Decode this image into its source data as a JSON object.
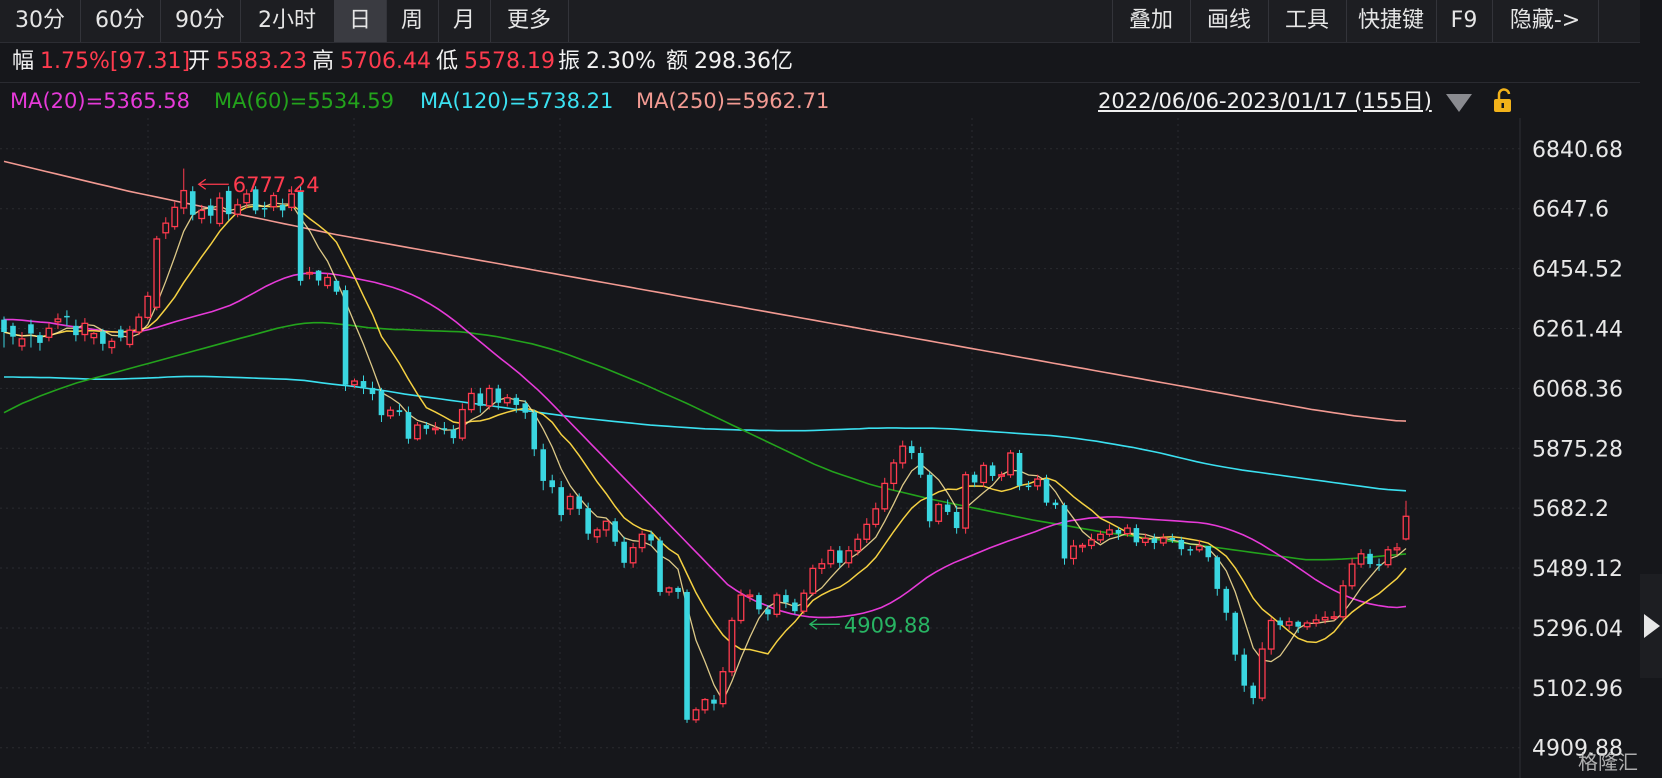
{
  "toolbar": {
    "periods": [
      "30分",
      "60分",
      "90分",
      "2小时",
      "日",
      "周",
      "月",
      "更多"
    ],
    "active": "日",
    "tools": [
      "叠加",
      "画线",
      "工具",
      "快捷键",
      "F9",
      "隐藏->"
    ]
  },
  "info": {
    "change_label": "幅",
    "change_value": "1.75%[97.31]",
    "open_label": "开",
    "open_value": "5583.23",
    "high_label": "高",
    "high_value": "5706.44",
    "low_label": "低",
    "low_value": "5578.19",
    "amp_label": "振",
    "amp_value": "2.30%",
    "amount_label": "额",
    "amount_value": "298.36亿"
  },
  "ma": [
    {
      "text": "MA(20)=5365.58",
      "color": "#e63ad8"
    },
    {
      "text": "MA(60)=5534.59",
      "color": "#23a31c"
    },
    {
      "text": "MA(120)=5738.21",
      "color": "#3be0f0"
    },
    {
      "text": "MA(250)=5962.71",
      "color": "#f29a92"
    }
  ],
  "date_range": "2022/06/06-2023/01/17 (155日)",
  "watermark": "格隆汇",
  "colors": {
    "up": "#ff3b4e",
    "down": "#3ad6e0",
    "ma5": "#f0f0f0",
    "ma10": "#f5d142"
  },
  "icons": {
    "dropdown": "triangle-down-icon",
    "lock": "lock-icon",
    "play": "play-icon"
  },
  "chart_data": {
    "type": "candlestick",
    "ylim": [
      4909,
      6940
    ],
    "yticks": [
      "6840.68",
      "6647.6",
      "6454.52",
      "6261.44",
      "6068.36",
      "5875.28",
      "5682.2",
      "5489.12",
      "5296.04",
      "5102.96",
      "4909.88"
    ],
    "annotations": [
      {
        "text": "6777.24",
        "kind": "high",
        "index": 21
      },
      {
        "text": "4909.88",
        "kind": "low",
        "index": 89
      }
    ],
    "closes": [
      6250,
      6235,
      6228,
      6245,
      6215,
      6262,
      6292,
      6300,
      6240,
      6278,
      6245,
      6212,
      6220,
      6232,
      6256,
      6298,
      6365,
      6550,
      6601,
      6652,
      6706,
      6628,
      6642,
      6625,
      6682,
      6630,
      6660,
      6695,
      6642,
      6645,
      6690,
      6642,
      6695,
      6415,
      6442,
      6416,
      6426,
      6380,
      6080,
      6092,
      6072,
      6050,
      5982,
      5998,
      5992,
      5906,
      5950,
      5938,
      5940,
      5936,
      5908,
      6000,
      6052,
      6012,
      6068,
      6022,
      6038,
      6015,
      5990,
      5872,
      5770,
      5750,
      5660,
      5720,
      5680,
      5600,
      5612,
      5640,
      5574,
      5506,
      5555,
      5598,
      5578,
      5412,
      5425,
      5412,
      5000,
      5032,
      5065,
      5052,
      5155,
      5320,
      5402,
      5402,
      5356,
      5340,
      5402,
      5378,
      5350,
      5408,
      5488,
      5503,
      5546,
      5506,
      5545,
      5582,
      5630,
      5680,
      5762,
      5828,
      5882,
      5860,
      5790,
      5640,
      5694,
      5670,
      5618,
      5790,
      5765,
      5820,
      5786,
      5790,
      5860,
      5755,
      5754,
      5776,
      5700,
      5692,
      5520,
      5560,
      5562,
      5580,
      5598,
      5612,
      5600,
      5618,
      5572,
      5585,
      5570,
      5586,
      5580,
      5550,
      5548,
      5560,
      5524,
      5422,
      5345,
      5210,
      5110,
      5070,
      5228,
      5320,
      5305,
      5316,
      5300,
      5312,
      5322,
      5330,
      5332,
      5432,
      5502,
      5535,
      5502,
      5500,
      5548,
      5554,
      5656
    ],
    "opens": [
      6290,
      6270,
      6205,
      6275,
      6240,
      6233,
      6283,
      6302,
      6270,
      6242,
      6232,
      6252,
      6200,
      6258,
      6210,
      6250,
      6297,
      6330,
      6570,
      6590,
      6650,
      6704,
      6616,
      6658,
      6600,
      6705,
      6630,
      6667,
      6710,
      6650,
      6654,
      6660,
      6652,
      6705,
      6438,
      6448,
      6400,
      6415,
      6385,
      6080,
      6092,
      6070,
      6060,
      5980,
      5998,
      5992,
      5906,
      5950,
      5938,
      5940,
      5936,
      5908,
      6000,
      6052,
      6012,
      6068,
      6022,
      6038,
      6020,
      5990,
      5872,
      5772,
      5750,
      5680,
      5720,
      5682,
      5590,
      5612,
      5640,
      5574,
      5506,
      5555,
      5598,
      5578,
      5412,
      5425,
      5412,
      5000,
      5032,
      5065,
      5052,
      5155,
      5320,
      5402,
      5402,
      5356,
      5340,
      5402,
      5378,
      5350,
      5408,
      5488,
      5503,
      5546,
      5506,
      5545,
      5582,
      5630,
      5680,
      5762,
      5828,
      5882,
      5860,
      5790,
      5640,
      5694,
      5670,
      5618,
      5790,
      5765,
      5820,
      5786,
      5790,
      5860,
      5755,
      5754,
      5776,
      5700,
      5692,
      5520,
      5560,
      5562,
      5580,
      5598,
      5612,
      5600,
      5618,
      5572,
      5585,
      5570,
      5586,
      5580,
      5550,
      5548,
      5560,
      5524,
      5422,
      5345,
      5210,
      5110,
      5070,
      5228,
      5320,
      5305,
      5316,
      5300,
      5312,
      5322,
      5330,
      5332,
      5432,
      5502,
      5535,
      5502,
      5500,
      5548,
      5583
    ],
    "highs": [
      6300,
      6280,
      6250,
      6290,
      6250,
      6280,
      6310,
      6320,
      6290,
      6295,
      6250,
      6260,
      6230,
      6270,
      6270,
      6310,
      6380,
      6560,
      6620,
      6670,
      6777,
      6720,
      6660,
      6680,
      6700,
      6720,
      6680,
      6710,
      6720,
      6670,
      6700,
      6680,
      6720,
      6720,
      6460,
      6450,
      6440,
      6420,
      6400,
      6100,
      6110,
      6090,
      6070,
      6010,
      6020,
      6010,
      5960,
      5960,
      5960,
      5960,
      5950,
      6020,
      6070,
      6070,
      6080,
      6080,
      6050,
      6050,
      6030,
      6000,
      5890,
      5790,
      5770,
      5730,
      5730,
      5700,
      5620,
      5640,
      5650,
      5590,
      5570,
      5610,
      5610,
      5590,
      5430,
      5430,
      5420,
      5040,
      5070,
      5080,
      5170,
      5330,
      5420,
      5420,
      5410,
      5370,
      5410,
      5420,
      5390,
      5420,
      5500,
      5520,
      5560,
      5560,
      5560,
      5600,
      5650,
      5700,
      5780,
      5840,
      5900,
      5900,
      5880,
      5800,
      5700,
      5710,
      5690,
      5800,
      5800,
      5830,
      5830,
      5800,
      5870,
      5870,
      5770,
      5790,
      5790,
      5710,
      5700,
      5580,
      5570,
      5600,
      5610,
      5630,
      5620,
      5630,
      5630,
      5600,
      5600,
      5600,
      5600,
      5590,
      5560,
      5580,
      5560,
      5530,
      5430,
      5350,
      5230,
      5120,
      5250,
      5330,
      5330,
      5330,
      5320,
      5320,
      5340,
      5350,
      5350,
      5450,
      5520,
      5550,
      5550,
      5520,
      5560,
      5570,
      5706
    ],
    "lows": [
      6200,
      6210,
      6190,
      6200,
      6190,
      6220,
      6260,
      6270,
      6220,
      6220,
      6210,
      6190,
      6180,
      6220,
      6200,
      6240,
      6290,
      6320,
      6550,
      6580,
      6630,
      6610,
      6600,
      6600,
      6590,
      6610,
      6620,
      6650,
      6630,
      6620,
      6640,
      6620,
      6640,
      6400,
      6420,
      6400,
      6390,
      6370,
      6060,
      6070,
      6050,
      6030,
      5960,
      5970,
      5980,
      5890,
      5900,
      5920,
      5920,
      5920,
      5890,
      5900,
      5990,
      5990,
      6000,
      6000,
      6010,
      5990,
      5970,
      5850,
      5740,
      5730,
      5640,
      5660,
      5660,
      5580,
      5570,
      5590,
      5560,
      5490,
      5490,
      5540,
      5560,
      5400,
      5400,
      5390,
      4990,
      4990,
      5020,
      5030,
      5040,
      5140,
      5310,
      5380,
      5340,
      5320,
      5330,
      5360,
      5340,
      5340,
      5400,
      5470,
      5490,
      5490,
      5490,
      5530,
      5570,
      5620,
      5670,
      5740,
      5810,
      5840,
      5780,
      5620,
      5630,
      5660,
      5600,
      5600,
      5750,
      5750,
      5770,
      5770,
      5780,
      5740,
      5740,
      5740,
      5690,
      5680,
      5500,
      5500,
      5540,
      5550,
      5570,
      5590,
      5580,
      5590,
      5560,
      5560,
      5550,
      5560,
      5570,
      5530,
      5530,
      5540,
      5510,
      5400,
      5320,
      5190,
      5090,
      5050,
      5060,
      5210,
      5290,
      5290,
      5280,
      5290,
      5300,
      5310,
      5320,
      5320,
      5420,
      5490,
      5490,
      5480,
      5490,
      5530,
      5578
    ],
    "series": [
      {
        "name": "MA(250)",
        "color": "#f29a92",
        "values": [
          6800,
          6792,
          6784,
          6776,
          6768,
          6760,
          6752,
          6744,
          6736,
          6728,
          6720,
          6712,
          6704,
          6697,
          6690,
          6683,
          6676,
          6669,
          6662,
          6655,
          6648,
          6641,
          6634,
          6627,
          6620,
          6613,
          6606,
          6599,
          6592,
          6585,
          6578,
          6571,
          6564,
          6558,
          6552,
          6546,
          6540,
          6534,
          6528,
          6522,
          6516,
          6510,
          6504,
          6498,
          6492,
          6486,
          6480,
          6474,
          6468,
          6462,
          6456,
          6450,
          6444,
          6438,
          6432,
          6426,
          6420,
          6414,
          6408,
          6402,
          6396,
          6390,
          6384,
          6378,
          6372,
          6366,
          6360,
          6354,
          6348,
          6342,
          6336,
          6330,
          6324,
          6318,
          6312,
          6306,
          6300,
          6294,
          6288,
          6282,
          6276,
          6270,
          6264,
          6258,
          6252,
          6246,
          6240,
          6234,
          6228,
          6222,
          6216,
          6210,
          6204,
          6198,
          6192,
          6186,
          6180,
          6174,
          6168,
          6162,
          6156,
          6150,
          6144,
          6138,
          6132,
          6126,
          6120,
          6114,
          6108,
          6102,
          6096,
          6090,
          6084,
          6078,
          6072,
          6066,
          6060,
          6054,
          6048,
          6042,
          6036,
          6030,
          6024,
          6018,
          6012,
          6006,
          6000,
          5995,
          5990,
          5985,
          5980,
          5976,
          5972,
          5968,
          5964,
          5962.71
        ]
      },
      {
        "name": "MA(120)",
        "color": "#3be0f0",
        "values": [
          6105,
          6105,
          6104,
          6104,
          6103,
          6103,
          6102,
          6101,
          6100,
          6099,
          6098,
          6098,
          6098,
          6099,
          6100,
          6101,
          6102,
          6103,
          6105,
          6106,
          6107,
          6107,
          6107,
          6106,
          6105,
          6104,
          6103,
          6102,
          6101,
          6100,
          6099,
          6098,
          6096,
          6094,
          6090,
          6086,
          6082,
          6079,
          6076,
          6072,
          6068,
          6064,
          6060,
          6055,
          6050,
          6046,
          6042,
          6038,
          6034,
          6030,
          6026,
          6022,
          6018,
          6014,
          6010,
          6006,
          6002,
          5998,
          5994,
          5990,
          5986,
          5982,
          5978,
          5974,
          5971,
          5968,
          5965,
          5962,
          5959,
          5956,
          5953,
          5950,
          5948,
          5946,
          5944,
          5942,
          5940,
          5938,
          5937,
          5936,
          5935,
          5934,
          5934,
          5933,
          5933,
          5932,
          5932,
          5932,
          5932,
          5933,
          5934,
          5935,
          5936,
          5937,
          5938,
          5940,
          5940,
          5941,
          5941,
          5940,
          5940,
          5940,
          5940,
          5939,
          5938,
          5936,
          5934,
          5932,
          5930,
          5928,
          5926,
          5924,
          5922,
          5920,
          5918,
          5916,
          5913,
          5910,
          5906,
          5902,
          5898,
          5893,
          5888,
          5883,
          5878,
          5872,
          5866,
          5860,
          5853,
          5846,
          5839,
          5832,
          5826,
          5820,
          5815,
          5810,
          5805,
          5801,
          5797,
          5793,
          5789,
          5785,
          5781,
          5777,
          5773,
          5769,
          5765,
          5761,
          5757,
          5753,
          5749,
          5745,
          5742,
          5740,
          5738.21
        ]
      },
      {
        "name": "MA(60)",
        "color": "#23a31c",
        "values": [
          5990,
          6005,
          6020,
          6032,
          6044,
          6055,
          6066,
          6076,
          6086,
          6094,
          6102,
          6110,
          6118,
          6126,
          6134,
          6142,
          6150,
          6158,
          6166,
          6174,
          6182,
          6190,
          6198,
          6206,
          6214,
          6222,
          6230,
          6238,
          6246,
          6254,
          6262,
          6268,
          6274,
          6278,
          6280,
          6280,
          6278,
          6275,
          6272,
          6268,
          6264,
          6262,
          6260,
          6258,
          6258,
          6256,
          6255,
          6254,
          6253,
          6252,
          6251,
          6248,
          6244,
          6240,
          6236,
          6230,
          6224,
          6218,
          6212,
          6204,
          6196,
          6187,
          6177,
          6166,
          6155,
          6144,
          6133,
          6121,
          6109,
          6097,
          6085,
          6072,
          6059,
          6046,
          6033,
          6020,
          6006,
          5992,
          5978,
          5964,
          5950,
          5936,
          5922,
          5908,
          5894,
          5880,
          5866,
          5852,
          5838,
          5824,
          5812,
          5800,
          5790,
          5780,
          5770,
          5760,
          5752,
          5745,
          5738,
          5731,
          5724,
          5717,
          5710,
          5704,
          5698,
          5692,
          5686,
          5680,
          5674,
          5668,
          5662,
          5656,
          5650,
          5644,
          5639,
          5634,
          5629,
          5624,
          5619,
          5614,
          5609,
          5604,
          5600,
          5596,
          5592,
          5588,
          5584,
          5580,
          5576,
          5572,
          5568,
          5564,
          5560,
          5556,
          5552,
          5548,
          5544,
          5540,
          5536,
          5532,
          5528,
          5524,
          5520,
          5516,
          5516,
          5516,
          5517,
          5518,
          5520,
          5522,
          5524,
          5527,
          5530,
          5532,
          5534.59
        ]
      },
      {
        "name": "MA(20)",
        "color": "#e63ad8",
        "values": [
          6290,
          6290,
          6288,
          6285,
          6282,
          6280,
          6275,
          6270,
          6266,
          6262,
          6258,
          6254,
          6250,
          6250,
          6250,
          6252,
          6258,
          6266,
          6275,
          6284,
          6292,
          6300,
          6308,
          6316,
          6326,
          6336,
          6350,
          6366,
          6382,
          6398,
          6412,
          6424,
          6433,
          6438,
          6440,
          6440,
          6438,
          6434,
          6428,
          6422,
          6416,
          6410,
          6402,
          6394,
          6384,
          6372,
          6358,
          6342,
          6324,
          6304,
          6282,
          6258,
          6234,
          6210,
          6186,
          6162,
          6140,
          6116,
          6090,
          6064,
          6036,
          6006,
          5976,
          5946,
          5916,
          5886,
          5856,
          5826,
          5796,
          5766,
          5736,
          5706,
          5676,
          5646,
          5616,
          5586,
          5556,
          5526,
          5496,
          5466,
          5436,
          5416,
          5399,
          5384,
          5372,
          5360,
          5350,
          5342,
          5336,
          5332,
          5330,
          5330,
          5331,
          5334,
          5338,
          5344,
          5352,
          5362,
          5376,
          5394,
          5414,
          5436,
          5458,
          5476,
          5492,
          5506,
          5518,
          5530,
          5542,
          5554,
          5565,
          5576,
          5586,
          5596,
          5606,
          5618,
          5628,
          5636,
          5642,
          5646,
          5650,
          5652,
          5654,
          5654,
          5652,
          5650,
          5648,
          5646,
          5644,
          5642,
          5640,
          5638,
          5636,
          5632,
          5626,
          5618,
          5608,
          5596,
          5582,
          5566,
          5548,
          5530,
          5512,
          5492,
          5472,
          5452,
          5434,
          5418,
          5404,
          5392,
          5382,
          5374,
          5368,
          5364,
          5362,
          5365.58
        ]
      }
    ]
  }
}
